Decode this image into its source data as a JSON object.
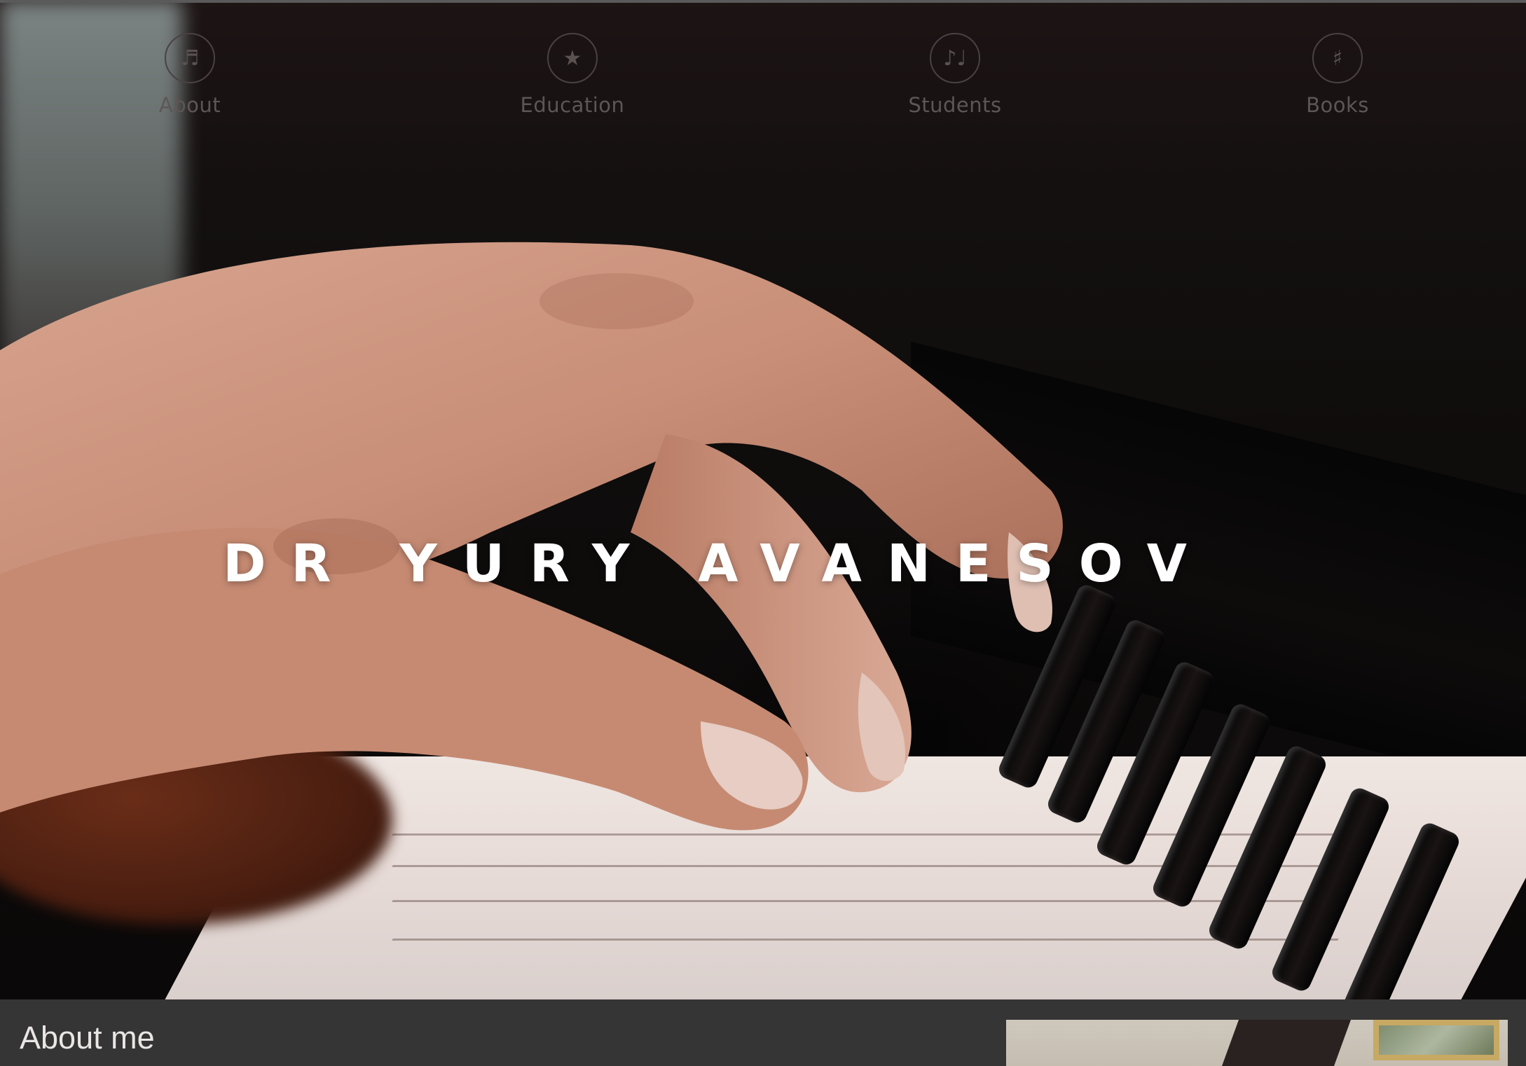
{
  "nav": {
    "items": [
      {
        "label": "About",
        "icon": "eighth-note-icon",
        "glyph": "♬"
      },
      {
        "label": "Education",
        "icon": "star-icon",
        "glyph": "★"
      },
      {
        "label": "Students",
        "icon": "music-notes-icon",
        "glyph": "♪♩"
      },
      {
        "label": "Books",
        "icon": "sharp-icon",
        "glyph": "♯"
      }
    ]
  },
  "hero": {
    "title": "DR YURY AVANESOV"
  },
  "about": {
    "heading": "About me"
  },
  "colors": {
    "band": "#363535",
    "nav_text": "#5e5656",
    "title": "#ffffff"
  }
}
